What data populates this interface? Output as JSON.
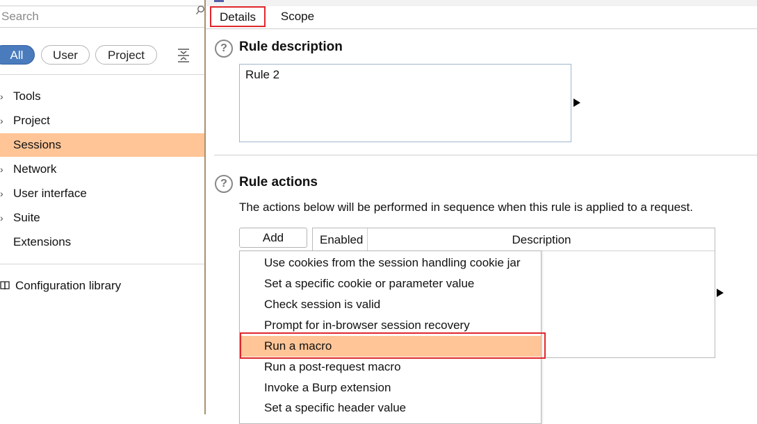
{
  "search": {
    "placeholder": "Search"
  },
  "filters": {
    "all": "All",
    "user": "User",
    "project": "Project"
  },
  "nav": {
    "items": [
      {
        "label": "Tools",
        "chevron": "›"
      },
      {
        "label": "Project",
        "chevron": "›"
      },
      {
        "label": "Sessions",
        "chevron": ""
      },
      {
        "label": "Network",
        "chevron": "›"
      },
      {
        "label": "User interface",
        "chevron": "›"
      },
      {
        "label": "Suite",
        "chevron": "›"
      },
      {
        "label": "Extensions",
        "chevron": ""
      }
    ],
    "selected_index": 2,
    "config_library": "Configuration library"
  },
  "tabs": {
    "details": "Details",
    "scope": "Scope"
  },
  "rule_description": {
    "title": "Rule description",
    "value": "Rule 2"
  },
  "rule_actions": {
    "title": "Rule actions",
    "description": "The actions below will be performed in sequence when this rule is applied to a request.",
    "add_label": "Add",
    "columns": {
      "enabled": "Enabled",
      "description": "Description"
    }
  },
  "add_menu": {
    "items": [
      "Use cookies from the session handling cookie jar",
      "Set a specific cookie or parameter value",
      "Check session is valid",
      "Prompt for in-browser session recovery",
      "Run a macro",
      "Run a post-request macro",
      "Invoke a Burp extension",
      "Set a specific header value"
    ],
    "highlighted_index": 4
  },
  "icons": {
    "search": "search-icon",
    "filter": "filter-icon",
    "help": "help-icon",
    "book": "book-icon"
  },
  "colors": {
    "selection": "#ffc597",
    "accent_blue": "#4a7bbd",
    "annotation_red": "#e0262b"
  }
}
